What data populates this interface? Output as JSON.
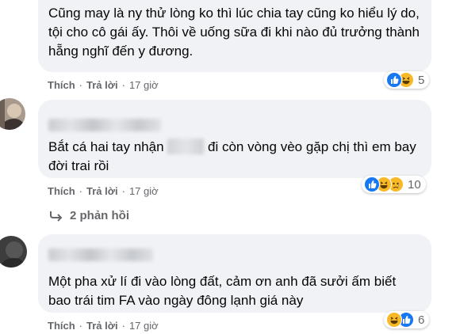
{
  "comments": [
    {
      "text": "Cũng may là ny thử lòng ko thì lúc chia tay cũng ko hiểu lý do, tội cho cô gái ấy. Thôi về uống sữa đi khi nào đủ trưởng thành hẵng nghĩ đến y đương.",
      "like_label": "Thích",
      "reply_label": "Trả lời",
      "time": "17 giờ",
      "reaction_icons": [
        "like-icon",
        "haha-icon"
      ],
      "reaction_count": "5"
    },
    {
      "text_before": "Bắt cá hai tay nhận",
      "text_after": "đi còn vòng vèo gặp chị thì em bay đời trai rồi",
      "like_label": "Thích",
      "reply_label": "Trả lời",
      "time": "17 giờ",
      "reaction_icons": [
        "like-icon",
        "haha-icon",
        "sad-icon"
      ],
      "reaction_count": "10",
      "replies_label": "2 phản hồi"
    },
    {
      "text": "Một pha xử lí đi vào lòng đất, cảm ơn anh đã sưởi ấm biết bao trái tim FA vào ngày đông lạnh giá này",
      "like_label": "Thích",
      "reply_label": "Trả lời",
      "time": "17 giờ",
      "reaction_icons": [
        "haha-icon",
        "like-icon"
      ],
      "reaction_count": "6"
    }
  ],
  "colors": {
    "bubble": "#f0f2f5",
    "like_blue": "#1877f2",
    "haha_yellow": "#f7b928",
    "meta_gray": "#65676b"
  }
}
